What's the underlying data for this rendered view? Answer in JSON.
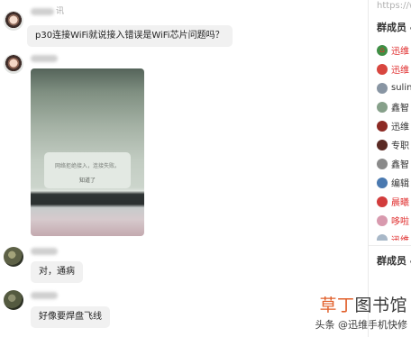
{
  "chat": {
    "sender1_name_fragment": "讯",
    "message1": "p30连接WiFi就说接入错误是WiFi芯片问题吗？",
    "photo": {
      "dialog_text": "网络拒绝接入，连接失败。",
      "dialog_button": "知道了"
    },
    "message3": "对，通病",
    "message4": "好像要焊盘飞线"
  },
  "sidebar": {
    "url": "https://w",
    "section_title": "群成员 4",
    "section_title_2": "群成员 4",
    "members": [
      {
        "name": "迅维",
        "name_color": "#e02e2e",
        "avatar_color": "#3f8f45",
        "icon": "house-icon"
      },
      {
        "name": "迅维",
        "name_color": "#e02e2e",
        "avatar_color": "#d8463f"
      },
      {
        "name": "sulin",
        "name_color": "#333333",
        "avatar_color": "#8895a3"
      },
      {
        "name": "鑫智",
        "name_color": "#333333",
        "avatar_color": "#86a08a"
      },
      {
        "name": "迅维",
        "name_color": "#333333",
        "avatar_color": "#8c2a24"
      },
      {
        "name": "专职",
        "name_color": "#333333",
        "avatar_color": "#5a2a24"
      },
      {
        "name": "鑫智",
        "name_color": "#333333",
        "avatar_color": "#8a8a8a"
      },
      {
        "name": "编辑",
        "name_color": "#333333",
        "avatar_color": "#4a79b0"
      },
      {
        "name": "晨曦",
        "name_color": "#e02e2e",
        "avatar_color": "#d23c3c"
      },
      {
        "name": "哆啦",
        "name_color": "#e02e2e",
        "avatar_color": "#d89aae"
      },
      {
        "name": "迅维",
        "name_color": "#e02e2e",
        "avatar_color": "#a8b8c8"
      }
    ]
  },
  "watermark": {
    "brand_orange": "草丁",
    "brand_dark": "图书馆",
    "credit": "头条 @迅维手机快修"
  },
  "colors": {
    "bubble_bg": "#f1f1f1",
    "member_red": "#e02e2e",
    "brand_orange": "#e15f2a"
  }
}
